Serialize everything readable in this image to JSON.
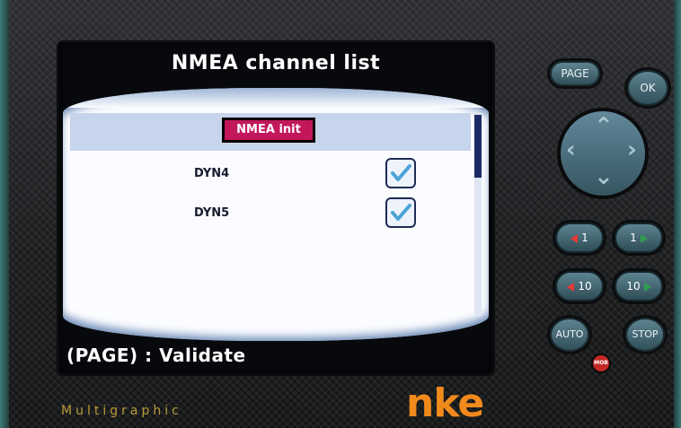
{
  "screen": {
    "title": "NMEA channel list",
    "init_button": "NMEA init",
    "channels": [
      {
        "label": "DYN4",
        "checked": true
      },
      {
        "label": "DYN5",
        "checked": true
      }
    ],
    "footer": "(PAGE) : Validate"
  },
  "keys": {
    "page": "PAGE",
    "ok": "OK",
    "minus1": "1",
    "plus1": "1",
    "minus10": "10",
    "plus10": "10",
    "auto": "AUTO",
    "stop": "STOP",
    "mob": "MOB"
  },
  "branding": {
    "model": "Multigraphic",
    "logo": "nke"
  },
  "colors": {
    "highlight": "#c6d4ec",
    "init_button": "#c2185b",
    "logo": "#f08a1c",
    "model_text": "#b99b3a"
  }
}
